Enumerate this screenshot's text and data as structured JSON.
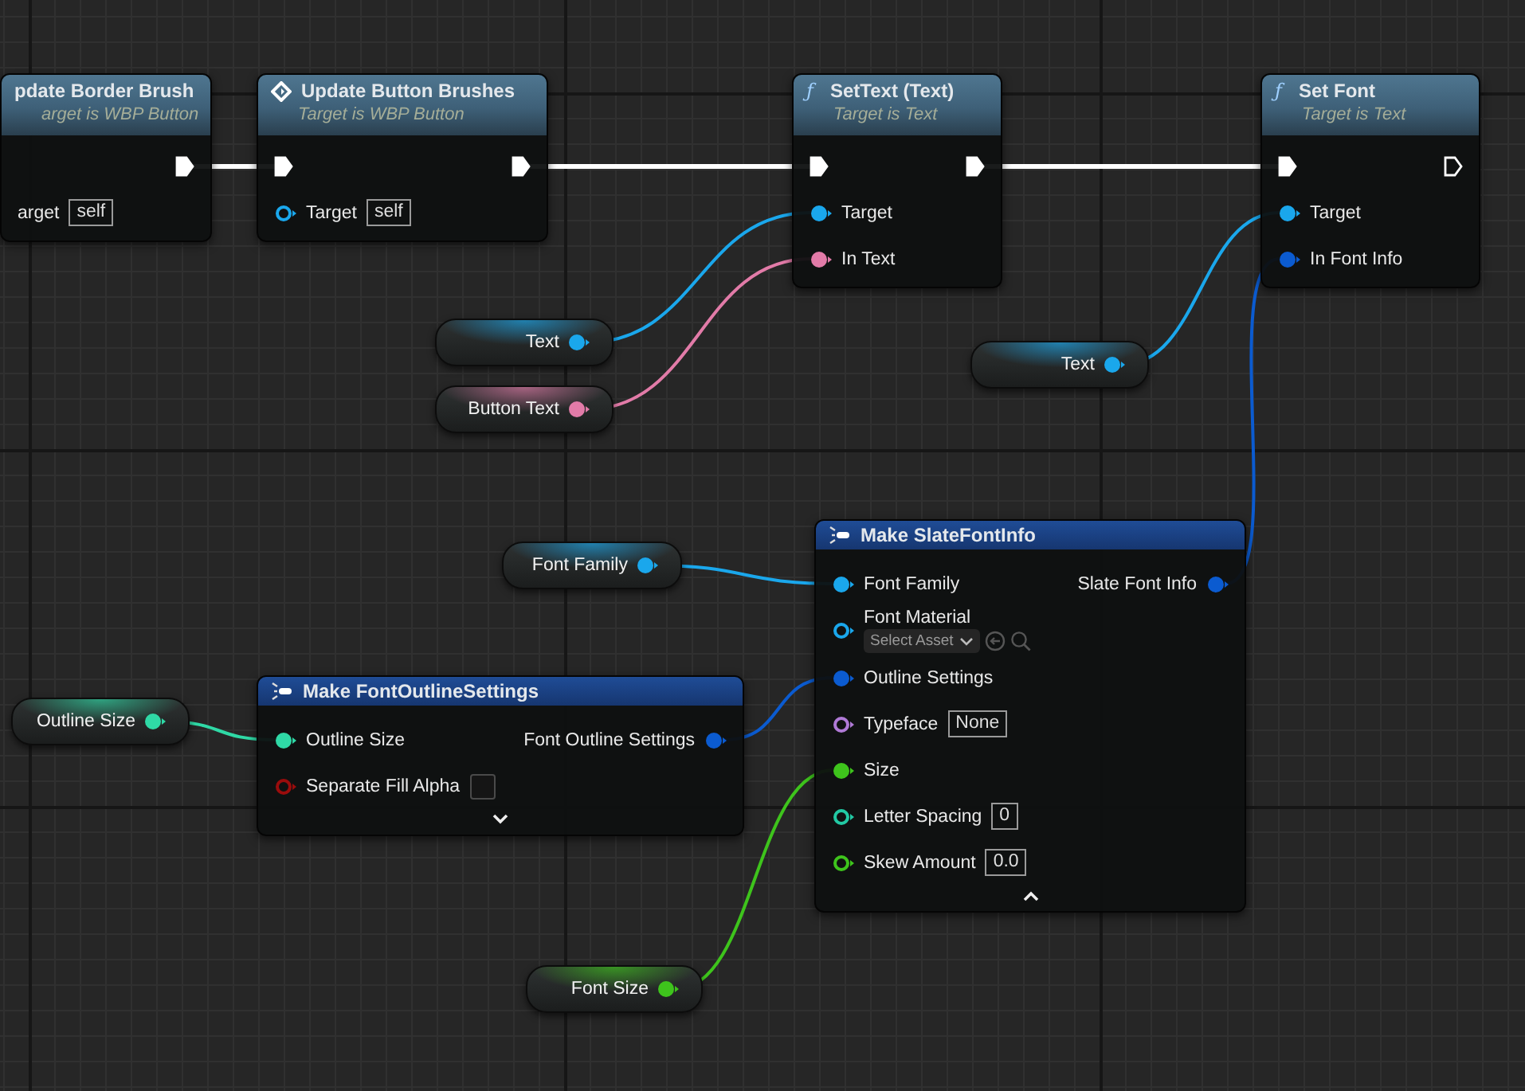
{
  "nodes": [
    {
      "kind": "call",
      "title": "pdate Border Brush",
      "subtitle": "arget is WBP Button",
      "rows": [
        {
          "out": {
            "kind": "exec",
            "connected": true
          }
        },
        {
          "in": {
            "kind": "label",
            "label": "arget",
            "value": "self"
          }
        }
      ]
    },
    {
      "kind": "call",
      "title": "Update Button Brushes",
      "subtitle": "Target is WBP Button",
      "rows": [
        {
          "in": {
            "kind": "exec",
            "connected": true
          },
          "out": {
            "kind": "exec",
            "connected": true
          }
        },
        {
          "in": {
            "kind": "data",
            "label": "Target",
            "color": "#1aa7ec",
            "connected": false,
            "value": "self"
          }
        }
      ]
    },
    {
      "kind": "call",
      "icon_text": "ƒ",
      "title": "SetText (Text)",
      "subtitle": "Target is Text",
      "rows": [
        {
          "in": {
            "kind": "exec",
            "connected": true
          },
          "out": {
            "kind": "exec",
            "connected": true
          }
        },
        {
          "in": {
            "kind": "data",
            "label": "Target",
            "color": "#1aa7ec",
            "connected": true
          }
        },
        {
          "in": {
            "kind": "data",
            "label": "In Text",
            "color": "#e27ba8",
            "connected": true
          }
        }
      ]
    },
    {
      "kind": "call",
      "icon_text": "ƒ",
      "title": "Set Font",
      "subtitle": "Target is Text",
      "rows": [
        {
          "in": {
            "kind": "exec",
            "connected": true
          },
          "out": {
            "kind": "exec",
            "connected": false
          }
        },
        {
          "in": {
            "kind": "data",
            "label": "Target",
            "color": "#1aa7ec",
            "connected": true
          }
        },
        {
          "in": {
            "kind": "data",
            "label": "In Font Info",
            "color": "#0b5bd0",
            "connected": true
          }
        }
      ]
    },
    {
      "kind": "variable",
      "label": "Text",
      "pin": {
        "color": "#1aa7ec",
        "connected": true
      }
    },
    {
      "kind": "variable",
      "label": "Button Text",
      "pin": {
        "color": "#e27ba8",
        "connected": true
      }
    },
    {
      "kind": "variable",
      "label": "Text",
      "pin": {
        "color": "#1aa7ec",
        "connected": true
      }
    },
    {
      "kind": "variable",
      "label": "Font Family",
      "pin": {
        "color": "#1aa7ec",
        "connected": true
      }
    },
    {
      "kind": "make",
      "title": "Make SlateFontInfo",
      "expanded": true,
      "rows": [
        {
          "in": {
            "kind": "data",
            "label": "Font Family",
            "color": "#1aa7ec",
            "connected": true
          },
          "out": {
            "kind": "data",
            "label": "Slate Font Info",
            "color": "#0b5bd0",
            "connected": true
          }
        },
        {
          "in": {
            "kind": "asset",
            "label": "Font Material",
            "color": "#1aa7ec",
            "connected": false,
            "picker": "Select Asset"
          }
        },
        {
          "in": {
            "kind": "data",
            "label": "Outline Settings",
            "color": "#0b5bd0",
            "connected": true
          }
        },
        {
          "in": {
            "kind": "data",
            "label": "Typeface",
            "color": "#b07ad6",
            "connected": false,
            "value": "None"
          }
        },
        {
          "in": {
            "kind": "data",
            "label": "Size",
            "color": "#3ec41c",
            "connected": true
          }
        },
        {
          "in": {
            "kind": "data",
            "label": "Letter Spacing",
            "color": "#22c9a4",
            "connected": false,
            "value": "0"
          }
        },
        {
          "in": {
            "kind": "data",
            "label": "Skew Amount",
            "color": "#3ec41c",
            "connected": false,
            "value": "0.0"
          }
        }
      ]
    },
    {
      "kind": "variable",
      "label": "Outline Size",
      "pin": {
        "color": "#2fd9a6",
        "connected": true
      }
    },
    {
      "kind": "make",
      "title": "Make FontOutlineSettings",
      "expanded": false,
      "rows": [
        {
          "in": {
            "kind": "data",
            "label": "Outline Size",
            "color": "#2fd9a6",
            "connected": true
          },
          "out": {
            "kind": "data",
            "label": "Font Outline Settings",
            "color": "#0b5bd0",
            "connected": true
          }
        },
        {
          "in": {
            "kind": "bool",
            "label": "Separate Fill Alpha",
            "color": "#9a0c0c",
            "connected": false,
            "checked": false
          }
        }
      ]
    },
    {
      "kind": "variable",
      "label": "Font Size",
      "pin": {
        "color": "#3ec41c",
        "connected": true
      }
    }
  ]
}
